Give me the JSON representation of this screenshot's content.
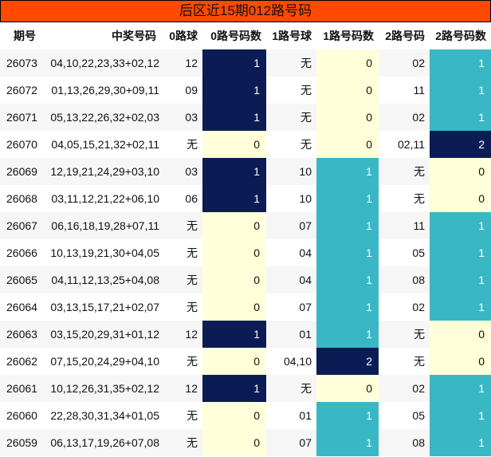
{
  "title": "后区近15期012路号码",
  "headers": [
    "期号",
    "中奖号码",
    "0路球",
    "0路号码数",
    "1路号球",
    "1路号码数",
    "2路号码",
    "2路号码数"
  ],
  "rows": [
    {
      "issue": "26073",
      "numbers": "04,10,22,23,33+02,12",
      "r0": "12",
      "c0": "1",
      "r1": "无",
      "c1": "0",
      "r2": "02",
      "c2": "1"
    },
    {
      "issue": "26072",
      "numbers": "01,13,26,29,30+09,11",
      "r0": "09",
      "c0": "1",
      "r1": "无",
      "c1": "0",
      "r2": "11",
      "c2": "1"
    },
    {
      "issue": "26071",
      "numbers": "05,13,22,26,32+02,03",
      "r0": "03",
      "c0": "1",
      "r1": "无",
      "c1": "0",
      "r2": "02",
      "c2": "1"
    },
    {
      "issue": "26070",
      "numbers": "04,05,15,21,32+02,11",
      "r0": "无",
      "c0": "0",
      "r1": "无",
      "c1": "0",
      "r2": "02,11",
      "c2": "2"
    },
    {
      "issue": "26069",
      "numbers": "12,19,21,24,29+03,10",
      "r0": "03",
      "c0": "1",
      "r1": "10",
      "c1": "1",
      "r2": "无",
      "c2": "0"
    },
    {
      "issue": "26068",
      "numbers": "03,11,12,21,22+06,10",
      "r0": "06",
      "c0": "1",
      "r1": "10",
      "c1": "1",
      "r2": "无",
      "c2": "0"
    },
    {
      "issue": "26067",
      "numbers": "06,16,18,19,28+07,11",
      "r0": "无",
      "c0": "0",
      "r1": "07",
      "c1": "1",
      "r2": "11",
      "c2": "1"
    },
    {
      "issue": "26066",
      "numbers": "10,13,19,21,30+04,05",
      "r0": "无",
      "c0": "0",
      "r1": "04",
      "c1": "1",
      "r2": "05",
      "c2": "1"
    },
    {
      "issue": "26065",
      "numbers": "04,11,12,13,25+04,08",
      "r0": "无",
      "c0": "0",
      "r1": "04",
      "c1": "1",
      "r2": "08",
      "c2": "1"
    },
    {
      "issue": "26064",
      "numbers": "03,13,15,17,21+02,07",
      "r0": "无",
      "c0": "0",
      "r1": "07",
      "c1": "1",
      "r2": "02",
      "c2": "1"
    },
    {
      "issue": "26063",
      "numbers": "03,15,20,29,31+01,12",
      "r0": "12",
      "c0": "1",
      "r1": "01",
      "c1": "1",
      "r2": "无",
      "c2": "0"
    },
    {
      "issue": "26062",
      "numbers": "07,15,20,24,29+04,10",
      "r0": "无",
      "c0": "0",
      "r1": "04,10",
      "c1": "2",
      "r2": "无",
      "c2": "0"
    },
    {
      "issue": "26061",
      "numbers": "10,12,26,31,35+02,12",
      "r0": "12",
      "c0": "1",
      "r1": "无",
      "c1": "0",
      "r2": "02",
      "c2": "1"
    },
    {
      "issue": "26060",
      "numbers": "22,28,30,31,34+01,05",
      "r0": "无",
      "c0": "0",
      "r1": "01",
      "c1": "1",
      "r2": "05",
      "c2": "1"
    },
    {
      "issue": "26059",
      "numbers": "06,13,17,19,26+07,08",
      "r0": "无",
      "c0": "0",
      "r1": "07",
      "c1": "1",
      "r2": "08",
      "c2": "1"
    }
  ],
  "colors": {
    "title_bg": "#ff4a00",
    "zero_bg": "#ffffd9",
    "count0_one_bg": "#0b1c55",
    "count_teal_bg": "#3ab7c4",
    "count_two_bg": "#0b1c55"
  }
}
